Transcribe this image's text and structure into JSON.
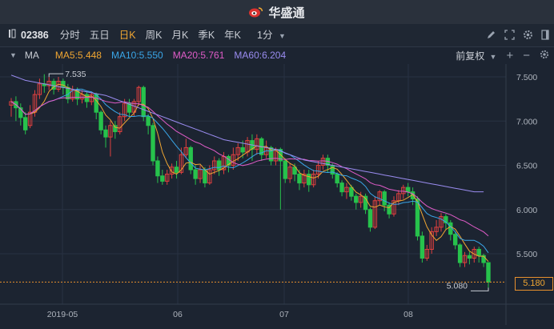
{
  "app": {
    "title": "华盛通"
  },
  "toolbar": {
    "stock_code": "02386",
    "periods": [
      {
        "label": "分时",
        "active": false
      },
      {
        "label": "五日",
        "active": false
      },
      {
        "label": "日K",
        "active": true
      },
      {
        "label": "周K",
        "active": false
      },
      {
        "label": "月K",
        "active": false
      },
      {
        "label": "季K",
        "active": false
      },
      {
        "label": "年K",
        "active": false
      }
    ],
    "interval": "1分"
  },
  "indicators": {
    "name": "MA",
    "items": [
      {
        "label": "MA5:5.448",
        "color": "#f0a632"
      },
      {
        "label": "MA10:5.550",
        "color": "#3aa6e8"
      },
      {
        "label": "MA20:5.761",
        "color": "#e05cc8"
      },
      {
        "label": "MA60:6.204",
        "color": "#9a8cf0"
      }
    ],
    "adjust": "前复权"
  },
  "colors": {
    "up": "#e0403f",
    "down": "#27c24c",
    "ma5": "#f0a632",
    "ma10": "#3aa6e8",
    "ma20": "#e05cc8",
    "ma60": "#9a8cf0"
  },
  "chart_data": {
    "type": "candlestick",
    "x_labels": [
      "2019-05",
      "06",
      "07",
      "08"
    ],
    "y_ticks": [
      "7.500",
      "7.000",
      "6.500",
      "6.000",
      "5.500"
    ],
    "ylim": [
      5.0,
      7.6
    ],
    "annotations": {
      "high": "7.535",
      "low": "5.080",
      "last": "5.180"
    },
    "candles": [
      [
        7.18,
        7.22,
        7.05,
        7.26
      ],
      [
        7.22,
        7.15,
        7.0,
        7.28
      ],
      [
        7.15,
        7.04,
        6.95,
        7.2
      ],
      [
        7.04,
        6.9,
        6.85,
        7.1
      ],
      [
        6.95,
        7.1,
        6.92,
        7.18
      ],
      [
        7.1,
        7.3,
        7.05,
        7.35
      ],
      [
        7.3,
        7.42,
        7.25,
        7.48
      ],
      [
        7.42,
        7.4,
        7.32,
        7.53
      ],
      [
        7.4,
        7.45,
        7.35,
        7.5
      ],
      [
        7.45,
        7.36,
        7.3,
        7.48
      ],
      [
        7.36,
        7.45,
        7.33,
        7.5
      ],
      [
        7.45,
        7.38,
        7.3,
        7.48
      ],
      [
        7.38,
        7.25,
        7.2,
        7.42
      ],
      [
        7.25,
        7.35,
        7.22,
        7.4
      ],
      [
        7.35,
        7.25,
        7.18,
        7.38
      ],
      [
        7.25,
        7.3,
        7.2,
        7.35
      ],
      [
        7.3,
        7.22,
        7.15,
        7.33
      ],
      [
        7.22,
        7.3,
        7.18,
        7.33
      ],
      [
        7.3,
        7.1,
        7.02,
        7.32
      ],
      [
        7.1,
        6.9,
        6.85,
        7.12
      ],
      [
        6.9,
        6.82,
        6.7,
        6.95
      ],
      [
        6.82,
        6.95,
        6.6,
        7.0
      ],
      [
        6.95,
        6.88,
        6.8,
        7.0
      ],
      [
        6.88,
        7.05,
        6.85,
        7.1
      ],
      [
        7.05,
        7.2,
        7.0,
        7.25
      ],
      [
        7.2,
        7.1,
        7.05,
        7.25
      ],
      [
        7.1,
        7.22,
        7.05,
        7.25
      ],
      [
        7.22,
        7.38,
        7.18,
        7.4
      ],
      [
        7.38,
        7.05,
        7.0,
        7.4
      ],
      [
        7.05,
        6.95,
        6.85,
        7.08
      ],
      [
        6.95,
        6.55,
        6.5,
        6.98
      ],
      [
        6.55,
        6.38,
        6.3,
        6.6
      ],
      [
        6.38,
        6.32,
        6.28,
        6.45
      ],
      [
        6.32,
        6.4,
        6.28,
        6.45
      ],
      [
        6.4,
        6.48,
        6.35,
        6.52
      ],
      [
        6.48,
        6.42,
        6.35,
        6.55
      ],
      [
        6.42,
        6.62,
        6.4,
        6.7
      ],
      [
        6.62,
        6.7,
        6.58,
        6.8
      ],
      [
        6.7,
        6.45,
        6.4,
        6.72
      ],
      [
        6.45,
        6.35,
        6.28,
        6.5
      ],
      [
        6.35,
        6.45,
        6.3,
        6.5
      ],
      [
        6.45,
        6.3,
        6.25,
        6.48
      ],
      [
        6.3,
        6.45,
        6.28,
        6.5
      ],
      [
        6.45,
        6.55,
        6.4,
        6.6
      ],
      [
        6.55,
        6.45,
        6.38,
        6.58
      ],
      [
        6.45,
        6.6,
        6.4,
        6.65
      ],
      [
        6.6,
        6.5,
        6.42,
        6.62
      ],
      [
        6.5,
        6.62,
        6.45,
        6.7
      ],
      [
        6.62,
        6.7,
        6.55,
        6.75
      ],
      [
        6.7,
        6.65,
        6.58,
        6.78
      ],
      [
        6.65,
        6.78,
        6.6,
        6.82
      ],
      [
        6.78,
        6.68,
        6.55,
        6.85
      ],
      [
        6.68,
        6.8,
        6.62,
        6.85
      ],
      [
        6.8,
        6.62,
        6.55,
        6.82
      ],
      [
        6.62,
        6.7,
        6.58,
        6.78
      ],
      [
        6.7,
        6.55,
        6.5,
        6.72
      ],
      [
        6.55,
        6.68,
        6.5,
        6.7
      ],
      [
        6.68,
        6.55,
        6.0,
        6.7
      ],
      [
        6.55,
        6.35,
        6.3,
        6.58
      ],
      [
        6.35,
        6.48,
        6.3,
        6.52
      ],
      [
        6.48,
        6.4,
        6.32,
        6.52
      ],
      [
        6.4,
        6.3,
        6.22,
        6.45
      ],
      [
        6.3,
        6.4,
        6.25,
        6.45
      ],
      [
        6.4,
        6.28,
        6.2,
        6.45
      ],
      [
        6.28,
        6.4,
        6.25,
        6.45
      ],
      [
        6.4,
        6.5,
        6.35,
        6.55
      ],
      [
        6.5,
        6.58,
        6.45,
        6.62
      ],
      [
        6.58,
        6.5,
        6.42,
        6.62
      ],
      [
        6.5,
        6.4,
        6.35,
        6.52
      ],
      [
        6.4,
        6.3,
        6.25,
        6.42
      ],
      [
        6.3,
        6.2,
        6.15,
        6.33
      ],
      [
        6.2,
        6.25,
        6.12,
        6.3
      ],
      [
        6.25,
        6.15,
        6.1,
        6.28
      ],
      [
        6.15,
        6.08,
        6.0,
        6.18
      ],
      [
        6.08,
        6.15,
        6.02,
        6.2
      ],
      [
        6.15,
        6.0,
        5.95,
        6.18
      ],
      [
        6.0,
        5.8,
        5.75,
        6.02
      ],
      [
        5.8,
        6.1,
        5.78,
        6.15
      ],
      [
        6.1,
        6.2,
        6.05,
        6.22
      ],
      [
        6.2,
        6.05,
        5.98,
        6.22
      ],
      [
        6.05,
        5.95,
        5.9,
        6.08
      ],
      [
        5.95,
        6.1,
        5.92,
        6.15
      ],
      [
        6.1,
        6.18,
        6.05,
        6.22
      ],
      [
        6.18,
        6.25,
        6.12,
        6.28
      ],
      [
        6.25,
        6.2,
        6.15,
        6.3
      ],
      [
        6.2,
        6.12,
        6.05,
        6.25
      ],
      [
        6.12,
        5.7,
        5.65,
        6.15
      ],
      [
        5.7,
        5.45,
        5.4,
        5.75
      ],
      [
        5.45,
        5.55,
        5.42,
        5.6
      ],
      [
        5.55,
        5.75,
        5.5,
        5.8
      ],
      [
        5.75,
        5.8,
        5.7,
        5.88
      ],
      [
        5.8,
        5.92,
        5.75,
        5.96
      ],
      [
        5.92,
        5.85,
        5.78,
        5.95
      ],
      [
        5.85,
        5.72,
        5.65,
        5.88
      ],
      [
        5.72,
        5.6,
        5.55,
        5.75
      ],
      [
        5.6,
        5.4,
        5.35,
        5.62
      ],
      [
        5.4,
        5.48,
        5.35,
        5.52
      ],
      [
        5.48,
        5.45,
        5.38,
        5.52
      ],
      [
        5.45,
        5.55,
        5.4,
        5.58
      ],
      [
        5.55,
        5.48,
        5.4,
        5.58
      ],
      [
        5.48,
        5.4,
        5.35,
        5.5
      ],
      [
        5.4,
        5.18,
        5.08,
        5.4
      ]
    ],
    "ma60": [
      7.52,
      7.5,
      7.48,
      7.46,
      7.45,
      7.44,
      7.43,
      7.42,
      7.41,
      7.4,
      7.39,
      7.38,
      7.37,
      7.36,
      7.35,
      7.34,
      7.33,
      7.32,
      7.31,
      7.3,
      7.29,
      7.27,
      7.25,
      7.23,
      7.21,
      7.19,
      7.17,
      7.15,
      7.13,
      7.11,
      7.09,
      7.07,
      7.05,
      7.03,
      7.01,
      6.99,
      6.97,
      6.95,
      6.93,
      6.91,
      6.89,
      6.87,
      6.85,
      6.83,
      6.81,
      6.79,
      6.78,
      6.77,
      6.76,
      6.75,
      6.74,
      6.73,
      6.72,
      6.71,
      6.7,
      6.69,
      6.68,
      6.66,
      6.64,
      6.62,
      6.6,
      6.58,
      6.56,
      6.55,
      6.54,
      6.53,
      6.52,
      6.51,
      6.5,
      6.49,
      6.48,
      6.47,
      6.46,
      6.45,
      6.44,
      6.43,
      6.42,
      6.41,
      6.4,
      6.39,
      6.38,
      6.37,
      6.36,
      6.35,
      6.34,
      6.33,
      6.32,
      6.31,
      6.3,
      6.29,
      6.28,
      6.27,
      6.26,
      6.25,
      6.24,
      6.23,
      6.22,
      6.21,
      6.2,
      6.2,
      6.2
    ]
  }
}
